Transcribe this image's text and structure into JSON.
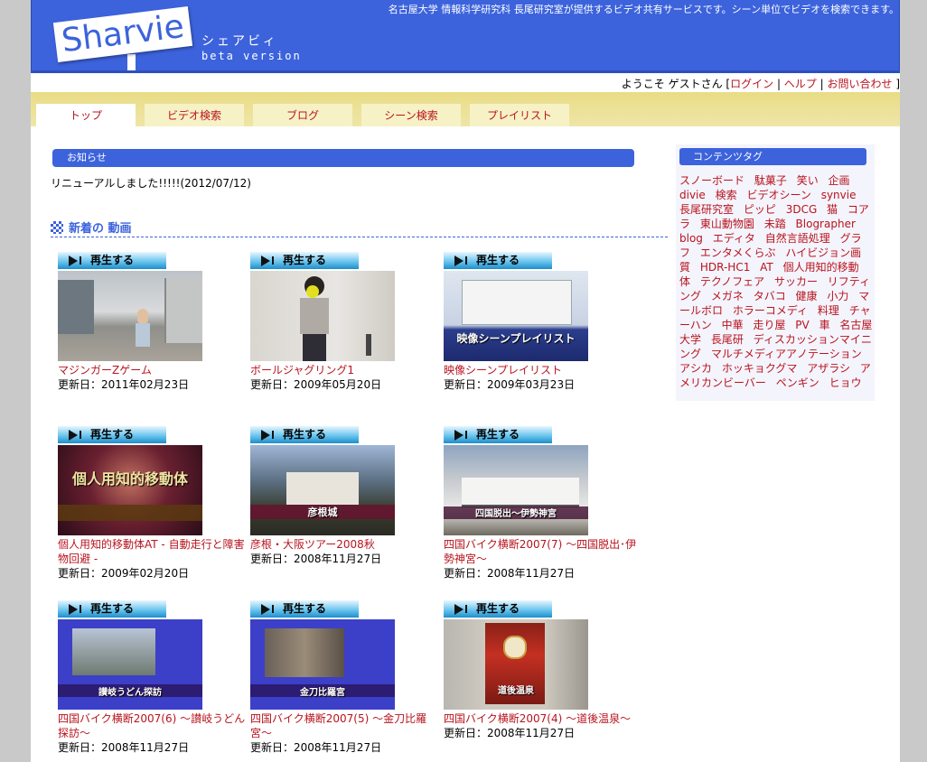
{
  "header": {
    "logo_text": "Sharvie",
    "logo_kana": "シェアビィ",
    "logo_beta": "beta version",
    "tagline": "名古屋大学 情報科学研究科 長尾研究室が提供するビデオ共有サービスです。シーン単位でビデオを検索できます。"
  },
  "welcome": {
    "greeting": "ようこそ ゲストさん [",
    "login": "ログイン",
    "sep1": " | ",
    "help": "ヘルプ",
    "sep2": " | ",
    "contact": "お問い合わせ",
    "end": " ]"
  },
  "nav": {
    "tabs": [
      "トップ",
      "ビデオ検索",
      "ブログ",
      "シーン検索",
      "プレイリスト"
    ]
  },
  "notice": {
    "heading": "お知らせ",
    "text": "リニューアルしました!!!!!(2012/07/12)"
  },
  "new_videos": {
    "heading": "新着の 動画",
    "play_label": "再生する",
    "items": [
      {
        "title": "マジンガーZゲーム",
        "date": "更新日：2011年02月23日",
        "caption": ""
      },
      {
        "title": "ボールジャグリング1",
        "date": "更新日：2009年05月20日",
        "caption": ""
      },
      {
        "title": "映像シーンプレイリスト",
        "date": "更新日：2009年03月23日",
        "caption": "映像シーンプレイリスト"
      },
      {
        "title": "個人用知的移動体AT - 自動走行と障害物回避 -",
        "date": "更新日：2009年02月20日",
        "caption": "個人用知的移動体"
      },
      {
        "title": "彦根・大阪ツアー2008秋",
        "date": "更新日：2008年11月27日",
        "caption": "彦根城"
      },
      {
        "title": "四国バイク横断2007(7) 〜四国脱出･伊勢神宮〜",
        "date": "更新日：2008年11月27日",
        "caption": "四国脱出～伊勢神宮"
      },
      {
        "title": "四国バイク横断2007(6) 〜讃岐うどん探訪〜",
        "date": "更新日：2008年11月27日",
        "caption": "讃岐うどん探訪"
      },
      {
        "title": "四国バイク横断2007(5) 〜金刀比羅宮〜",
        "date": "更新日：2008年11月27日",
        "caption": "金刀比羅宮"
      },
      {
        "title": "四国バイク横断2007(4) 〜道後温泉〜",
        "date": "更新日：2008年11月27日",
        "caption": "道後温泉"
      }
    ]
  },
  "sidebar": {
    "heading": "コンテンツタグ",
    "tags": [
      "スノーボード",
      "駄菓子",
      "笑い",
      "企画",
      "divie",
      "検索",
      "ビデオシーン",
      "synvie",
      "長尾研究室",
      "ピッピ",
      "3DCG",
      "猫",
      "コアラ",
      "東山動物園",
      "未踏",
      "Blographer",
      "blog",
      "エディタ",
      "自然言語処理",
      "グラフ",
      "エンタメくらぶ",
      "ハイビジョン画質",
      "HDR-HC1",
      "AT",
      "個人用知的移動体",
      "テクノフェア",
      "サッカー",
      "リフティング",
      "メガネ",
      "タバコ",
      "健康",
      "小力",
      "マールボロ",
      "ホラーコメディ",
      "料理",
      "チャーハン",
      "中華",
      "走り屋",
      "PV",
      "車",
      "名古屋大学",
      "長尾研",
      "ディスカッションマイニング",
      "マルチメディアアノテーション",
      "アシカ",
      "ホッキョクグマ",
      "アザラシ",
      "アメリカンビーバー",
      "ペンギン",
      "ヒョウ"
    ]
  }
}
